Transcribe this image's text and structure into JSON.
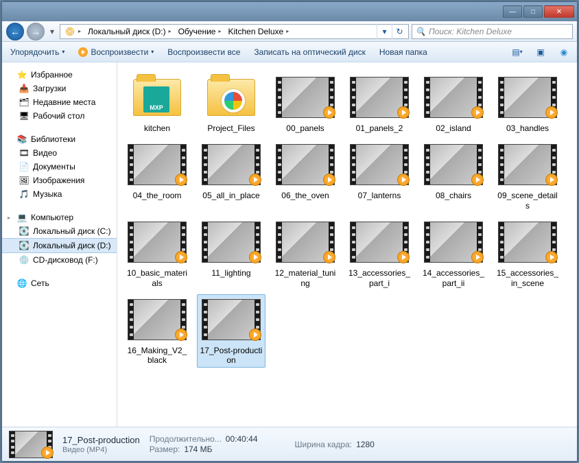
{
  "breadcrumb": {
    "segments": [
      "Локальный диск (D:)",
      "Обучение",
      "Kitchen Deluxe"
    ]
  },
  "search": {
    "placeholder": "Поиск: Kitchen Deluxe"
  },
  "toolbar": {
    "organize": "Упорядочить",
    "play": "Воспроизвести",
    "play_all": "Воспроизвести все",
    "burn": "Записать на оптический диск",
    "new_folder": "Новая папка"
  },
  "sidebar": {
    "favorites": {
      "label": "Избранное",
      "items": [
        "Загрузки",
        "Недавние места",
        "Рабочий стол"
      ]
    },
    "libraries": {
      "label": "Библиотеки",
      "items": [
        "Видео",
        "Документы",
        "Изображения",
        "Музыка"
      ]
    },
    "computer": {
      "label": "Компьютер",
      "items": [
        "Локальный диск (C:)",
        "Локальный диск (D:)",
        "CD-дисковод (F:)"
      ],
      "selected_index": 1
    },
    "network": {
      "label": "Сеть"
    }
  },
  "folders": [
    {
      "name": "kitchen",
      "kind": "kitchen"
    },
    {
      "name": "Project_Files",
      "kind": "project"
    }
  ],
  "videos": [
    "00_panels",
    "01_panels_2",
    "02_island",
    "03_handles",
    "04_the_room",
    "05_all_in_place",
    "06_the_oven",
    "07_lanterns",
    "08_chairs",
    "09_scene_details",
    "10_basic_materials",
    "11_lighting",
    "12_material_tuning",
    "13_accessories_part_i",
    "14_accessories_part_ii",
    "15_accessories_in_scene",
    "16_Making_V2_black",
    "17_Post-production"
  ],
  "selected_video_index": 17,
  "status": {
    "name": "17_Post-production",
    "type": "Видео (MP4)",
    "duration_label": "Продолжительно...",
    "duration_value": "00:40:44",
    "size_label": "Размер:",
    "size_value": "174 МБ",
    "width_label": "Ширина кадра:",
    "width_value": "1280"
  }
}
